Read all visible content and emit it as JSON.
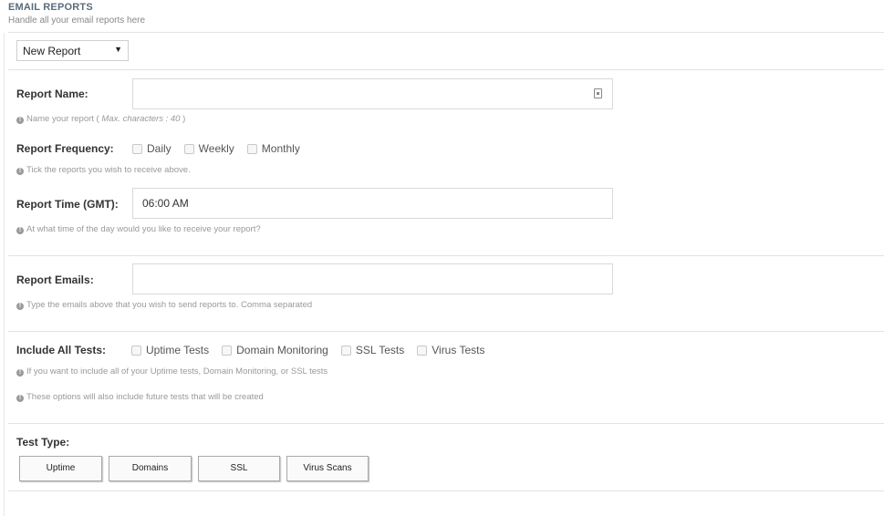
{
  "header": {
    "title": "EMAIL REPORTS",
    "subtitle": "Handle all your email reports here"
  },
  "report_select": {
    "value": "New Report"
  },
  "report_name": {
    "label": "Report Name:",
    "value": "",
    "hint_prefix": "Name your report ( ",
    "hint_italic": "Max. characters : 40",
    "hint_suffix": " )"
  },
  "report_frequency": {
    "label": "Report Frequency:",
    "options": [
      "Daily",
      "Weekly",
      "Monthly"
    ],
    "hint": "Tick the reports you wish to receive above."
  },
  "report_time": {
    "label": "Report Time (GMT):",
    "value": "06:00 AM",
    "hint": "At what time of the day would you like to receive your report?"
  },
  "report_emails": {
    "label": "Report Emails:",
    "value": "",
    "hint": "Type the emails above that you wish to send reports to. Comma separated"
  },
  "include_all": {
    "label": "Include All Tests:",
    "options": [
      "Uptime Tests",
      "Domain Monitoring",
      "SSL Tests",
      "Virus Tests"
    ],
    "hint1": "If you want to include all of your Uptime tests, Domain Monitoring, or SSL tests",
    "hint2": "These options will also include future tests that will be created"
  },
  "test_type": {
    "label": "Test Type:",
    "buttons": [
      "Uptime",
      "Domains",
      "SSL",
      "Virus Scans"
    ]
  },
  "icons": {
    "info": "info-circle-icon",
    "lock": "lock-icon",
    "dropdown": "caret-down-icon"
  }
}
